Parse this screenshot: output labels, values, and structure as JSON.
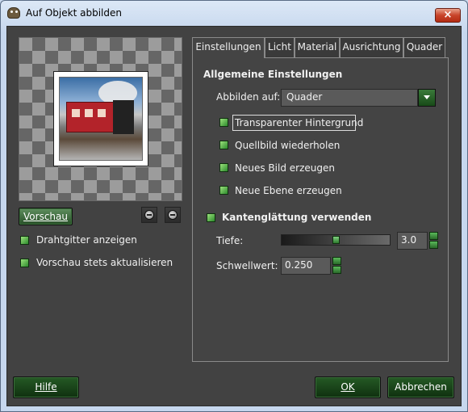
{
  "window": {
    "title": "Auf Objekt abbilden",
    "close_glyph": "×"
  },
  "preview": {
    "button_label": "Vorschau",
    "zoom_out_icon": "zoom-out-icon",
    "zoom_in_icon": "zoom-in-icon",
    "options": [
      {
        "label": "Drahtgitter anzeigen",
        "checked": true
      },
      {
        "label": "Vorschau stets aktualisieren",
        "checked": true
      }
    ]
  },
  "tabs": [
    {
      "label": "Einstellungen",
      "active": true
    },
    {
      "label": "Licht",
      "active": false
    },
    {
      "label": "Material",
      "active": false
    },
    {
      "label": "Ausrichtung",
      "active": false
    },
    {
      "label": "Quader",
      "active": false
    }
  ],
  "general": {
    "heading": "Allgemeine Einstellungen",
    "map_to_label": "Abbilden auf:",
    "map_to_value": "Quader",
    "checkboxes": [
      {
        "label": "Transparenter Hintergrund",
        "checked": true
      },
      {
        "label": "Quellbild wiederholen",
        "checked": true
      },
      {
        "label": "Neues Bild erzeugen",
        "checked": true
      },
      {
        "label": "Neue Ebene erzeugen",
        "checked": true
      }
    ],
    "antialias_label": "Kantenglättung verwenden",
    "antialias_checked": true,
    "depth_label": "Tiefe:",
    "depth_value": "3.0",
    "depth_fraction": 0.5,
    "threshold_label": "Schwellwert:",
    "threshold_value": "0.250"
  },
  "footer": {
    "help_label": "Hilfe",
    "ok_label": "OK",
    "cancel_label": "Abbrechen"
  },
  "colors": {
    "background": "#424242",
    "accent_green": "#2f7a2f",
    "text": "#f0f0f0"
  }
}
